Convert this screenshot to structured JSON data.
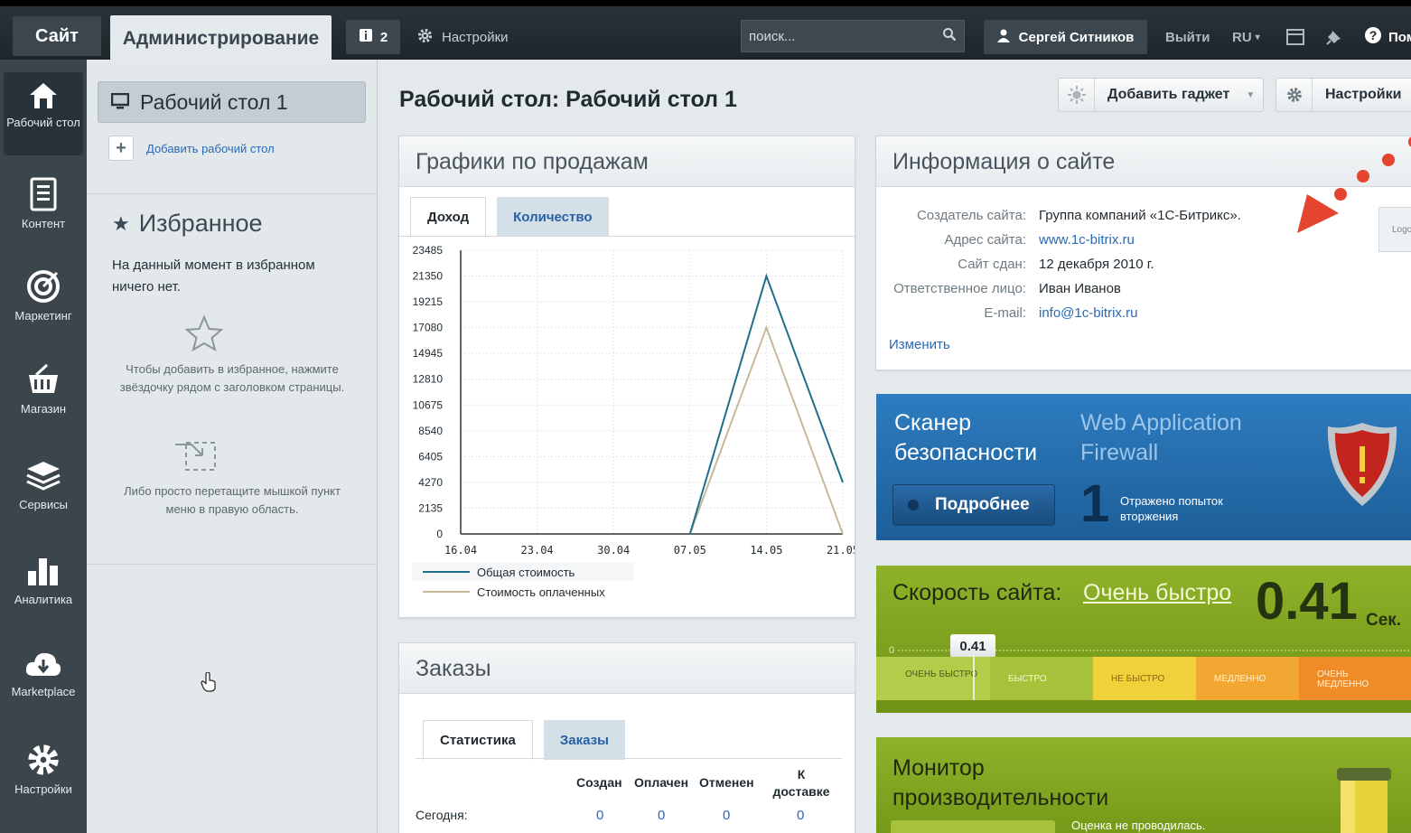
{
  "topbar": {
    "site_tab": "Сайт",
    "admin_tab": "Администрирование",
    "notifications_count": "2",
    "settings_label": "Настройки",
    "search_placeholder": "поиск...",
    "user_name": "Сергей Ситников",
    "logout": "Выйти",
    "language": "RU",
    "help": "Пом"
  },
  "leftnav": [
    {
      "label": "Рабочий стол",
      "icon": "home-icon"
    },
    {
      "label": "Контент",
      "icon": "document-icon"
    },
    {
      "label": "Маркетинг",
      "icon": "target-icon"
    },
    {
      "label": "Магазин",
      "icon": "basket-icon"
    },
    {
      "label": "Сервисы",
      "icon": "layers-icon"
    },
    {
      "label": "Аналитика",
      "icon": "bar-chart-icon"
    },
    {
      "label": "Marketplace",
      "icon": "cloud-download-icon"
    },
    {
      "label": "Настройки",
      "icon": "gear-icon"
    }
  ],
  "sidebar": {
    "workspace": "Рабочий стол 1",
    "add_workspace": "Добавить рабочий стол",
    "favorites_title": "Избранное",
    "favorites_empty": "На данный момент в избранном ничего нет.",
    "hint_star": "Чтобы добавить в избранное, нажмите звёздочку рядом с заголовком страницы.",
    "hint_drag": "Либо просто перетащите мышкой пункт меню в правую область."
  },
  "main": {
    "title": "Рабочий стол: Рабочий стол 1",
    "add_gadget": "Добавить гаджет",
    "settings": "Настройки"
  },
  "sales": {
    "title": "Графики по продажам",
    "tab_income": "Доход",
    "tab_quantity": "Количество",
    "legend_total": "Общая стоимость",
    "legend_paid": "Стоимость оплаченных"
  },
  "chart_data": {
    "type": "line",
    "x": [
      "16.04",
      "23.04",
      "30.04",
      "07.05",
      "14.05",
      "21.05"
    ],
    "y_ticks": [
      0,
      2135,
      4270,
      6405,
      8540,
      10675,
      12810,
      14945,
      17080,
      19215,
      21350,
      23485
    ],
    "ylim": [
      0,
      23485
    ],
    "series": [
      {
        "name": "Общая стоимость",
        "color": "#1f6f8b",
        "points": [
          [
            0,
            0
          ],
          [
            1,
            0
          ],
          [
            2,
            0
          ],
          [
            3,
            0
          ],
          [
            4,
            21350
          ],
          [
            5,
            4270
          ]
        ]
      },
      {
        "name": "Стоимость оплаченных",
        "color": "#c8b89b",
        "points": [
          [
            0,
            0
          ],
          [
            1,
            0
          ],
          [
            2,
            0
          ],
          [
            3,
            0
          ],
          [
            4,
            17080
          ],
          [
            5,
            0
          ]
        ]
      }
    ],
    "grid": true
  },
  "site_info": {
    "title": "Информация о сайте",
    "rows": [
      {
        "k": "Создатель сайта:",
        "v": "Группа компаний «1С-Битрикс».",
        "link": false
      },
      {
        "k": "Адрес сайта:",
        "v": "www.1c-bitrix.ru",
        "link": true
      },
      {
        "k": "Сайт сдан:",
        "v": "12 декабря 2010 г.",
        "link": false
      },
      {
        "k": "Ответственное лицо:",
        "v": "Иван Иванов",
        "link": false
      },
      {
        "k": "E-mail:",
        "v": "info@1c-bitrix.ru",
        "link": true
      }
    ],
    "edit": "Изменить",
    "logo_text": "Logo"
  },
  "scanner": {
    "title": "Сканер безопасности",
    "waf": "Web Application Firewall",
    "button": "Подробнее",
    "count": "1",
    "count_label": "Отражено попыток вторжения"
  },
  "speed": {
    "label": "Скорость сайта:",
    "value_text": "Очень быстро",
    "seconds": "0.41",
    "unit": "Сек.",
    "marker": "0.41",
    "zero": "0",
    "segments": [
      "ОЧЕНЬ БЫСТРО",
      "БЫСТРО",
      "НЕ БЫСТРО",
      "МЕДЛЕННО",
      "ОЧЕНЬ МЕДЛЕННО"
    ]
  },
  "orders": {
    "title": "Заказы",
    "tab_stats": "Статистика",
    "tab_orders": "Заказы",
    "columns": [
      "Создан",
      "Оплачен",
      "Отменен",
      "К доставке"
    ],
    "rows": [
      {
        "label": "Сегодня:",
        "values": [
          "0",
          "0",
          "0",
          "0"
        ]
      }
    ]
  },
  "monitor": {
    "title": "Монитор производительности",
    "status": "Оценка не проводилась."
  }
}
